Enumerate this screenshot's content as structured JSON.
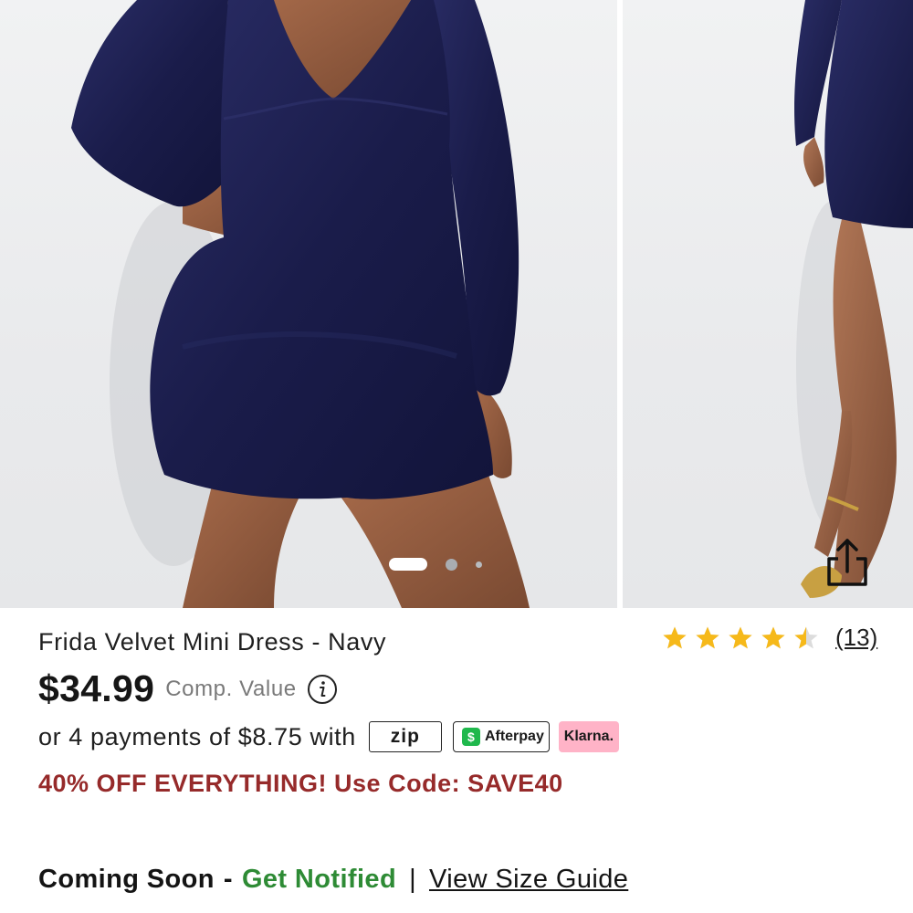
{
  "gallery": {
    "slides": [
      "dress-front-view",
      "dress-side-view"
    ],
    "active_slide": 1,
    "slide_count": 3
  },
  "product": {
    "title": "Frida Velvet Mini Dress - Navy",
    "price": "$34.99",
    "comp_value_label": "Comp. Value",
    "rating_value": 4.5,
    "rating_max": 5,
    "review_count": "(13)"
  },
  "payments": {
    "text": "or 4 payments of $8.75 with",
    "zip_label": "zip",
    "afterpay_label": "Afterpay",
    "afterpay_symbol": "$",
    "klarna_label": "Klarna."
  },
  "promo": {
    "text": "40% OFF EVERYTHING! Use Code: SAVE40"
  },
  "availability": {
    "status": "Coming Soon",
    "separator": "-",
    "notify_label": "Get Notified",
    "divider": "|",
    "size_guide_label": "View Size Guide"
  },
  "colors": {
    "star": "#f6b91a",
    "promo": "#962a2a",
    "notify": "#2e8b35",
    "dress": "#1e2152",
    "klarna_bg": "#ffb3c7",
    "afterpay_green": "#1fb84c"
  },
  "icons": {
    "share": "share-icon",
    "info": "info-icon",
    "star": "star-icon"
  }
}
